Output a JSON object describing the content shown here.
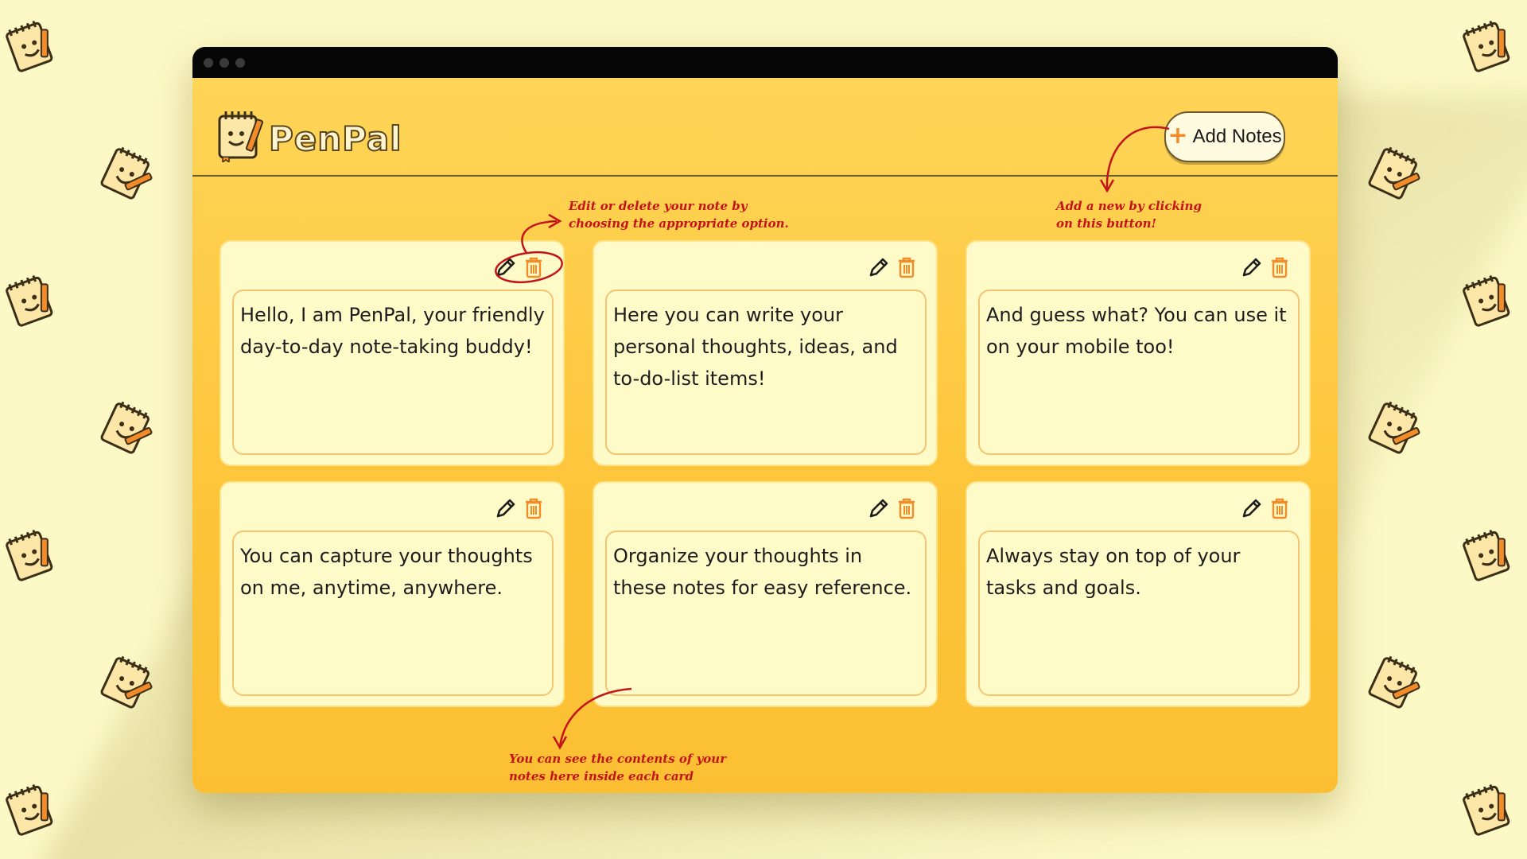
{
  "app": {
    "brand_name": "PenPal",
    "add_button_label": "Add Notes"
  },
  "notes": [
    {
      "text": "Hello, I am PenPal, your friendly day-to-day note-taking buddy!"
    },
    {
      "text": "Here you can write your personal thoughts, ideas, and to-do-list items!"
    },
    {
      "text": "And guess what? You can use it on your mobile too!"
    },
    {
      "text": "You can capture your thoughts on me, anytime, anywhere."
    },
    {
      "text": "Organize your thoughts in these notes for easy reference."
    },
    {
      "text": "Always stay on top of your tasks and goals."
    }
  ],
  "annotations": {
    "edit_delete": "Edit or delete your note by\nchoosing the appropriate option.",
    "add_new": "Add a new by clicking\non this button!",
    "contents": "You can see the contents of your\nnotes here inside each card"
  },
  "icons": {
    "edit": "pencil-icon",
    "delete": "trash-icon",
    "logo": "notepad-mascot-icon",
    "add": "plus-icon"
  },
  "colors": {
    "background": "#fdf9c6",
    "window": "#fdc53a",
    "card": "#fffbc9",
    "accent_orange": "#f28c28",
    "annotation_red": "#c4141b",
    "titlebar": "#060606"
  }
}
